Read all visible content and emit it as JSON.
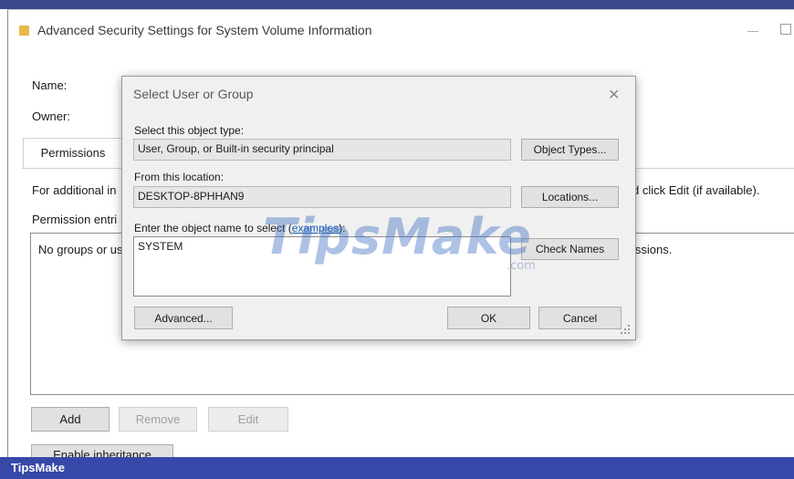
{
  "window": {
    "title": "Advanced Security Settings for System Volume Information"
  },
  "main": {
    "name_label": "Name:",
    "owner_label": "Owner:",
    "tab_permissions": "Permissions",
    "info_text_left": "For additional in",
    "info_text_right": "d click Edit (if available).",
    "permission_entries_label": "Permission entri",
    "list_empty_left": "No groups or us",
    "list_empty_right": "issions.",
    "add_label": "Add",
    "remove_label": "Remove",
    "edit_label": "Edit",
    "enable_inheritance_label": "Enable inheritance"
  },
  "dialog": {
    "title": "Select User or Group",
    "object_type_label": "Select this object type:",
    "object_type_value": "User, Group, or Built-in security principal",
    "object_types_button": "Object Types...",
    "location_label": "From this location:",
    "location_value": "DESKTOP-8PHHAN9",
    "locations_button": "Locations...",
    "object_name_label_prefix": "Enter the object name to select (",
    "object_name_link": "examples",
    "object_name_label_suffix": "):",
    "object_name_value": "SYSTEM",
    "check_names_button": "Check Names",
    "advanced_button": "Advanced...",
    "ok_button": "OK",
    "cancel_button": "Cancel"
  },
  "watermark": {
    "text": "TipsMake",
    "suffix": ".com"
  },
  "footer": {
    "brand": "TipsMake"
  },
  "colors": {
    "footer_bar": "#3848a8",
    "link": "#1a5fb4"
  }
}
